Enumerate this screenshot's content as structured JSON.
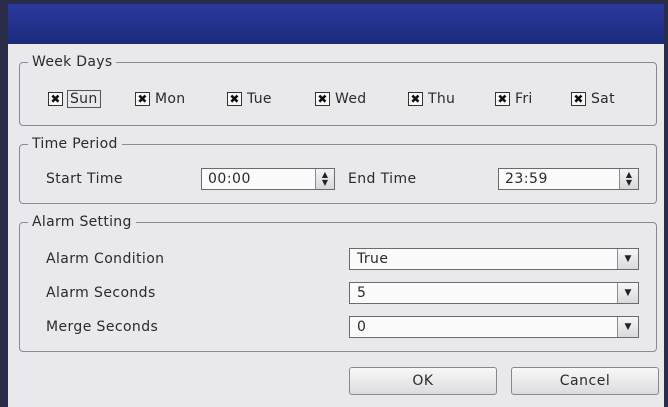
{
  "weekdays": {
    "legend": "Week Days",
    "items": [
      {
        "label": "Sun",
        "checked": true
      },
      {
        "label": "Mon",
        "checked": true
      },
      {
        "label": "Tue",
        "checked": true
      },
      {
        "label": "Wed",
        "checked": true
      },
      {
        "label": "Thu",
        "checked": true
      },
      {
        "label": "Fri",
        "checked": true
      },
      {
        "label": "Sat",
        "checked": true
      }
    ],
    "check_glyph": "✖"
  },
  "period": {
    "legend": "Time Period",
    "start_label": "Start Time",
    "start_value": "00:00",
    "end_label": "End Time",
    "end_value": "23:59"
  },
  "alarm": {
    "legend": "Alarm Setting",
    "condition_label": "Alarm Condition",
    "condition_value": "True",
    "seconds_label": "Alarm Seconds",
    "seconds_value": "5",
    "merge_label": "Merge Seconds",
    "merge_value": "0"
  },
  "buttons": {
    "ok": "OK",
    "cancel": "Cancel"
  },
  "colors": {
    "titlebar": "#223088",
    "dialog_bg": "#e9e9ec"
  }
}
